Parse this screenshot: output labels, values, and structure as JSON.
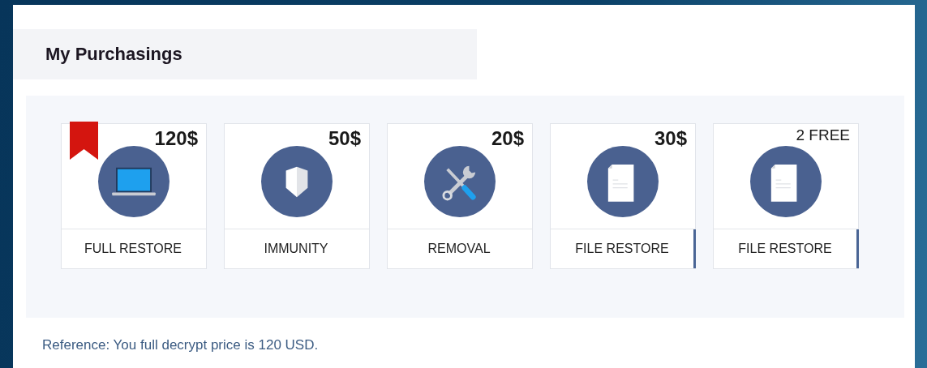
{
  "title": "My Purchasings",
  "items": [
    {
      "label": "FULL RESTORE",
      "price": "120$",
      "free": false,
      "kind": "laptop",
      "bookmarked": true,
      "selected": false
    },
    {
      "label": "IMMUNITY",
      "price": "50$",
      "free": false,
      "kind": "shield",
      "bookmarked": false,
      "selected": false
    },
    {
      "label": "REMOVAL",
      "price": "20$",
      "free": false,
      "kind": "tools",
      "bookmarked": false,
      "selected": false
    },
    {
      "label": "FILE RESTORE",
      "price": "30$",
      "free": false,
      "kind": "document",
      "bookmarked": false,
      "selected": true
    },
    {
      "label": "FILE RESTORE",
      "price": "2 FREE",
      "free": true,
      "kind": "document",
      "bookmarked": false,
      "selected": true
    }
  ],
  "note": "Reference: You full decrypt price is 120 USD."
}
